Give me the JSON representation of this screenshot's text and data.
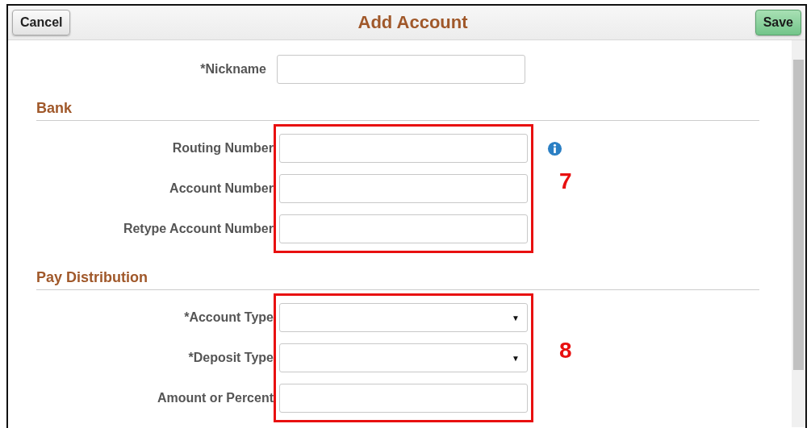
{
  "header": {
    "cancel": "Cancel",
    "title": "Add Account",
    "save": "Save"
  },
  "nickname": {
    "label": "*Nickname"
  },
  "sections": [
    {
      "title": "Bank",
      "callout": "7",
      "fields": [
        {
          "label": "Routing Number",
          "kind": "text",
          "info": true
        },
        {
          "label": "Account Number",
          "kind": "text",
          "info": false
        },
        {
          "label": "Retype Account Number",
          "kind": "text",
          "info": false
        }
      ]
    },
    {
      "title": "Pay Distribution",
      "callout": "8",
      "fields": [
        {
          "label": "*Account Type",
          "kind": "dropdown",
          "caret": "▼",
          "info": false
        },
        {
          "label": "*Deposit Type",
          "kind": "dropdown",
          "caret": "▼",
          "info": false
        },
        {
          "label": "Amount or Percent",
          "kind": "text",
          "info": false
        }
      ]
    }
  ]
}
